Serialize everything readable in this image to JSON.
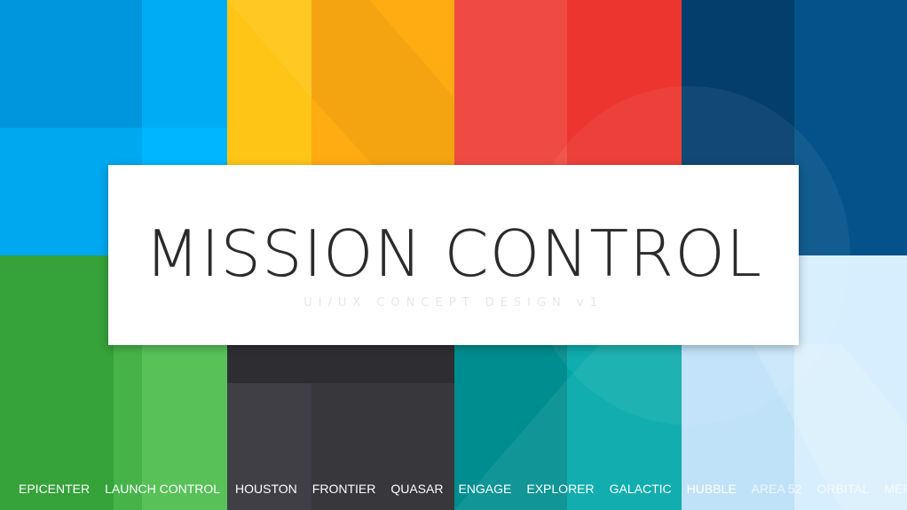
{
  "title": "MISSION CONTROL",
  "subtitle": "UI/UX CONCEPT DESIGN v1",
  "nav": [
    "EPICENTER",
    "LAUNCH CONTROL",
    "HOUSTON",
    "FRONTIER",
    "QUASAR",
    "ENGAGE",
    "EXPLORER",
    "GALACTIC",
    "HUBBLE",
    "AREA 52",
    "ORBITAL",
    "MERCURY"
  ],
  "colors": {
    "blue": "#00a8f0",
    "amber": "#ffb20f",
    "red": "#ee3e36",
    "navy": "#03497e",
    "green": "#3daa40",
    "dark": "#3a393e",
    "teal": "#009a9b",
    "sky": "#c9e7fb"
  }
}
